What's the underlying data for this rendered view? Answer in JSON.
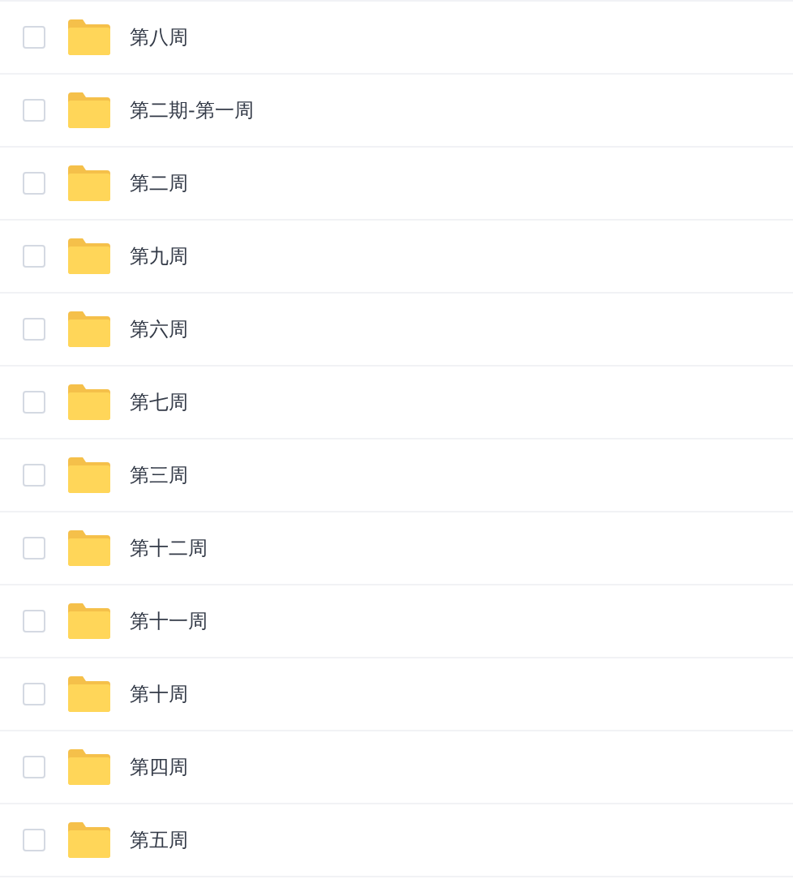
{
  "files": [
    {
      "name": "第八周",
      "checked": false
    },
    {
      "name": "第二期-第一周",
      "checked": false
    },
    {
      "name": "第二周",
      "checked": false
    },
    {
      "name": "第九周",
      "checked": false
    },
    {
      "name": "第六周",
      "checked": false
    },
    {
      "name": "第七周",
      "checked": false
    },
    {
      "name": "第三周",
      "checked": false
    },
    {
      "name": "第十二周",
      "checked": false
    },
    {
      "name": "第十一周",
      "checked": false
    },
    {
      "name": "第十周",
      "checked": false
    },
    {
      "name": "第四周",
      "checked": false
    },
    {
      "name": "第五周",
      "checked": false
    }
  ]
}
